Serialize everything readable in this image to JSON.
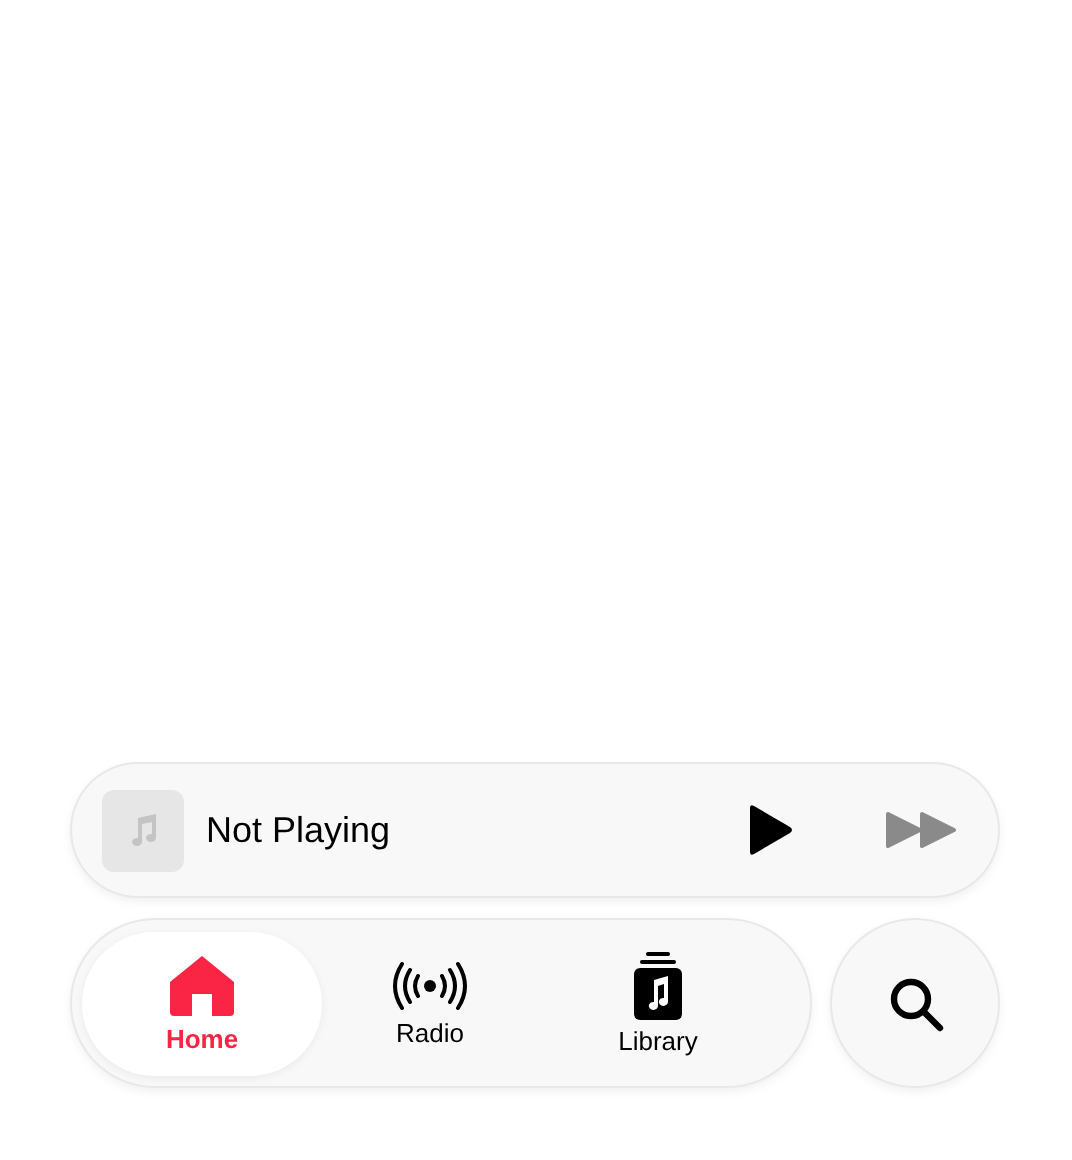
{
  "mini_player": {
    "title": "Not Playing",
    "next_enabled": false
  },
  "tabs": [
    {
      "kind": "home",
      "label": "Home",
      "selected": true
    },
    {
      "kind": "radio",
      "label": "Radio",
      "selected": false
    },
    {
      "kind": "library",
      "label": "Library",
      "selected": false
    }
  ]
}
